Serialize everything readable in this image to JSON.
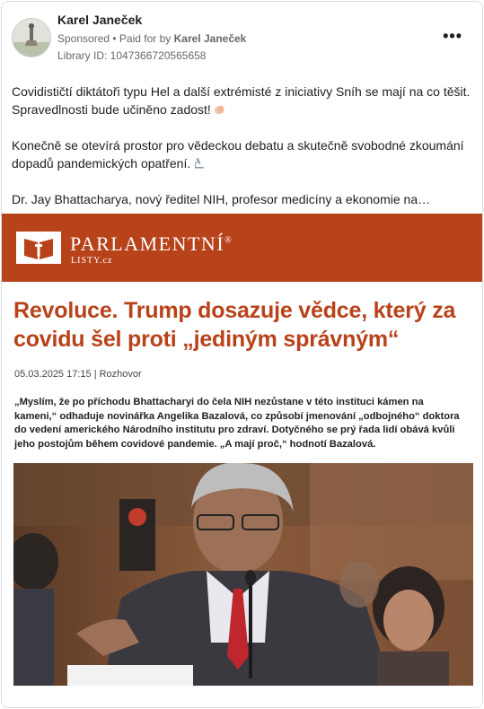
{
  "post": {
    "author": "Karel Janeček",
    "sponsored_label": "Sponsored",
    "paid_for_prefix": " • Paid for by ",
    "paid_for_name": "Karel Janeček",
    "library_id": "Library ID: 1047366720565658",
    "more_label": "•••",
    "paragraphs": [
      "Covidističtí diktátoři typu Hel a další extrémisté z iniciativy Sníh se mají na co těšit. Spravedlnosti bude učiněno zadost!",
      "Konečně se otevírá prostor pro vědeckou debatu a skutečně svobodné zkoumání dopadů pandemických opatření.",
      "Dr. Jay Bhattacharya, nový ředitel NIH, profesor medicíny a ekonomie na…"
    ],
    "paragraph_icons": [
      "clapping-hands-icon",
      "microscope-icon"
    ]
  },
  "banner": {
    "brand_title": "PARLAMENTNÍ",
    "brand_registered": "®",
    "brand_sub": "LISTY.cz",
    "color": "#b8421a"
  },
  "article": {
    "headline": "Revoluce. Trump dosazuje vědce, který za covidu šel proti „jediným správným“",
    "meta": "05.03.2025 17:15 | Rozhovor",
    "lead": "„Myslím, že po příchodu Bhattacharyi do čela NIH nezůstane v této instituci kámen na kameni,“ odhaduje novinářka Angelika Bazalová, co způsobí jmenování „odbojného“ doktora do vedení amerického Národního institutu pro zdraví. Dotyčného se prý řada lidí obává kvůli jeho postojům během covidové pandemie. „A mají proč,“ hodnotí Bazalová."
  }
}
